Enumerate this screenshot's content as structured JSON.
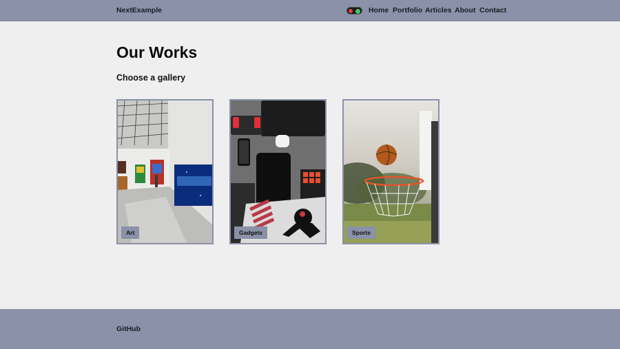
{
  "header": {
    "brand": "NextExample",
    "nav": [
      "Home",
      "Portfolio",
      "Articles",
      "About",
      "Contact"
    ]
  },
  "theme_toggle": {
    "icon": "theme-toggle-icon"
  },
  "main": {
    "title": "Our Works",
    "subtitle": "Choose a gallery",
    "galleries": [
      {
        "label": "Art"
      },
      {
        "label": "Gadgets"
      },
      {
        "label": "Sports"
      }
    ]
  },
  "footer": {
    "link": "GitHub"
  },
  "colors": {
    "nav_bg": "#8a91a8",
    "page_bg": "#efefef",
    "text": "#111111"
  }
}
